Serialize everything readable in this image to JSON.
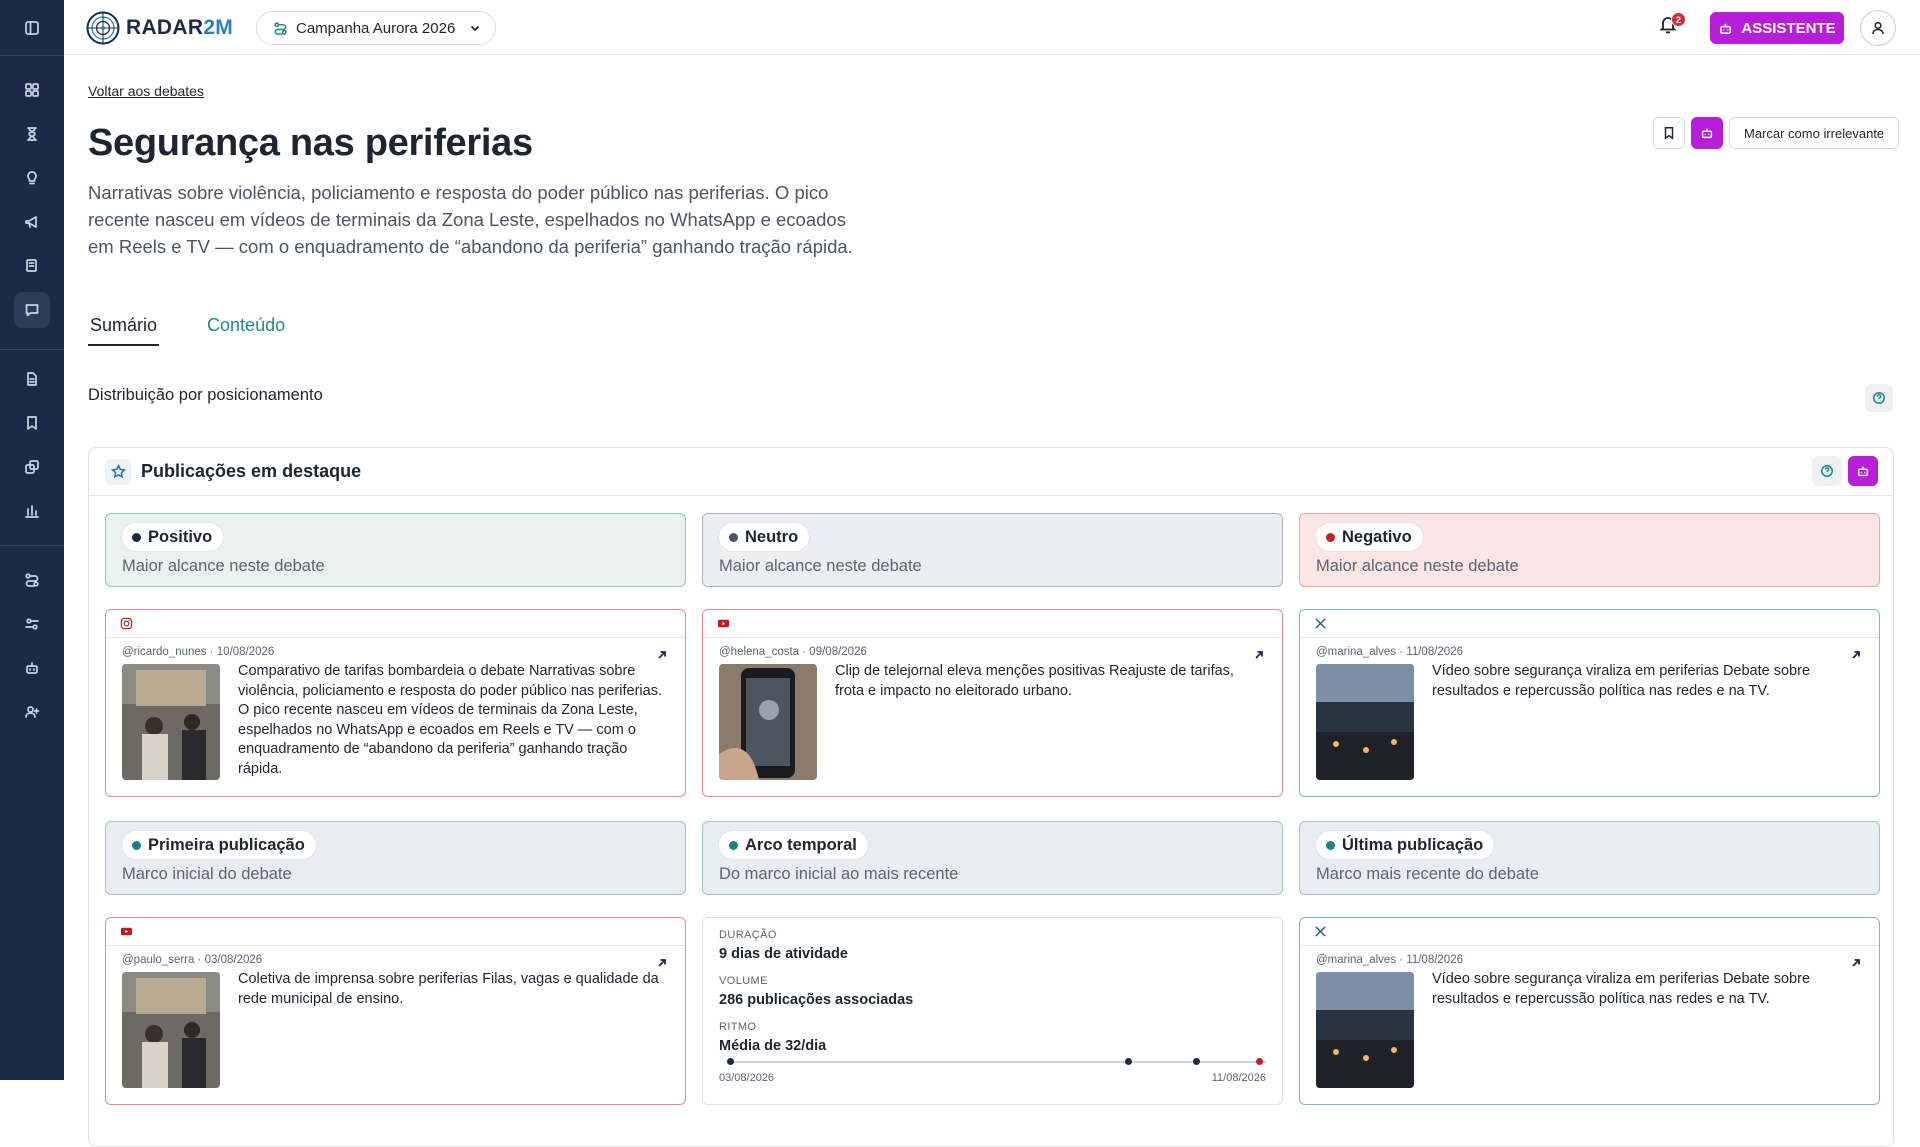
{
  "header": {
    "logo_text": "RADAR",
    "logo_accent": "2M",
    "campaign": "Campanha Aurora 2026",
    "notification_count": "2",
    "assistant_label": "ASSISTENTE"
  },
  "page": {
    "back_link": "Voltar aos debates",
    "title": "Segurança nas periferias",
    "description": "Narrativas sobre violência, policiamento e resposta do poder público nas periferias. O pico recente nasceu em vídeos de terminais da Zona Leste, espelhados no WhatsApp e ecoados em Reels e TV — com o enquadramento de “abandono da periferia” ganhando tração rápida.",
    "mark_irrelevant": "Marcar como irrelevante",
    "tabs": [
      {
        "label": "Sumário",
        "active": true
      },
      {
        "label": "Conteúdo",
        "active": false
      }
    ],
    "distribution_label": "Distribuição por posicionamento"
  },
  "highlights": {
    "title": "Publicações em destaque",
    "positions": [
      {
        "label": "Positivo",
        "subtitle": "Maior alcance neste debate",
        "dot_color": "#1c2b45"
      },
      {
        "label": "Neutro",
        "subtitle": "Maior alcance neste debate",
        "dot_color": "#4a5568"
      },
      {
        "label": "Negativo",
        "subtitle": "Maior alcance neste debate",
        "dot_color": "#c81e2a"
      }
    ],
    "posts_top": [
      {
        "platform": "instagram-icon",
        "meta": "@ricardo_nunes · 10/08/2026",
        "text": "Comparativo de tarifas bombardeia o debate Narrativas sobre violência, policiamento e resposta do poder público nas periferias. O pico recente nasceu em vídeos de terminais da Zona Leste, espelhados no WhatsApp e ecoados em Reels e TV — com o enquadramento de “abandono da periferia” ganhando tração rápida."
      },
      {
        "platform": "youtube-icon",
        "meta": "@helena_costa · 09/08/2026",
        "text": "Clip de telejornal eleva menções positivas Reajuste de tarifas, frota e impacto no eleitorado urbano."
      },
      {
        "platform": "x-icon",
        "meta": "@marina_alves · 11/08/2026",
        "text": "Vídeo sobre segurança viraliza em periferias Debate sobre resultados e repercussão política nas redes e na TV."
      }
    ],
    "milestones": [
      {
        "label": "Primeira publicação",
        "subtitle": "Marco inicial do debate",
        "dot_color": "#1f7f86"
      },
      {
        "label": "Arco temporal",
        "subtitle": "Do marco inicial ao mais recente",
        "dot_color": "#1f7f86"
      },
      {
        "label": "Última publicação",
        "subtitle": "Marco mais recente do debate",
        "dot_color": "#1f7f86"
      }
    ],
    "first_post": {
      "platform": "youtube-icon",
      "meta": "@paulo_serra · 03/08/2026",
      "text": "Coletiva de imprensa sobre periferias Filas, vagas e qualidade da rede municipal de ensino."
    },
    "last_post": {
      "platform": "x-icon",
      "meta": "@marina_alves · 11/08/2026",
      "text": "Vídeo sobre segurança viraliza em periferias Debate sobre resultados e repercussão política nas redes e na TV."
    },
    "arc": {
      "duration_label": "DURAÇÃO",
      "duration_value": "9 dias de atividade",
      "volume_label": "VOLUME",
      "volume_value": "286 publicações associadas",
      "pace_label": "RITMO",
      "pace_value": "Média de 32/dia",
      "start_date": "03/08/2026",
      "end_date": "11/08/2026"
    }
  },
  "colors": {
    "sidebar": "#1c2b45",
    "accent_magenta": "#b81ed9",
    "teal": "#1f8a8a"
  }
}
